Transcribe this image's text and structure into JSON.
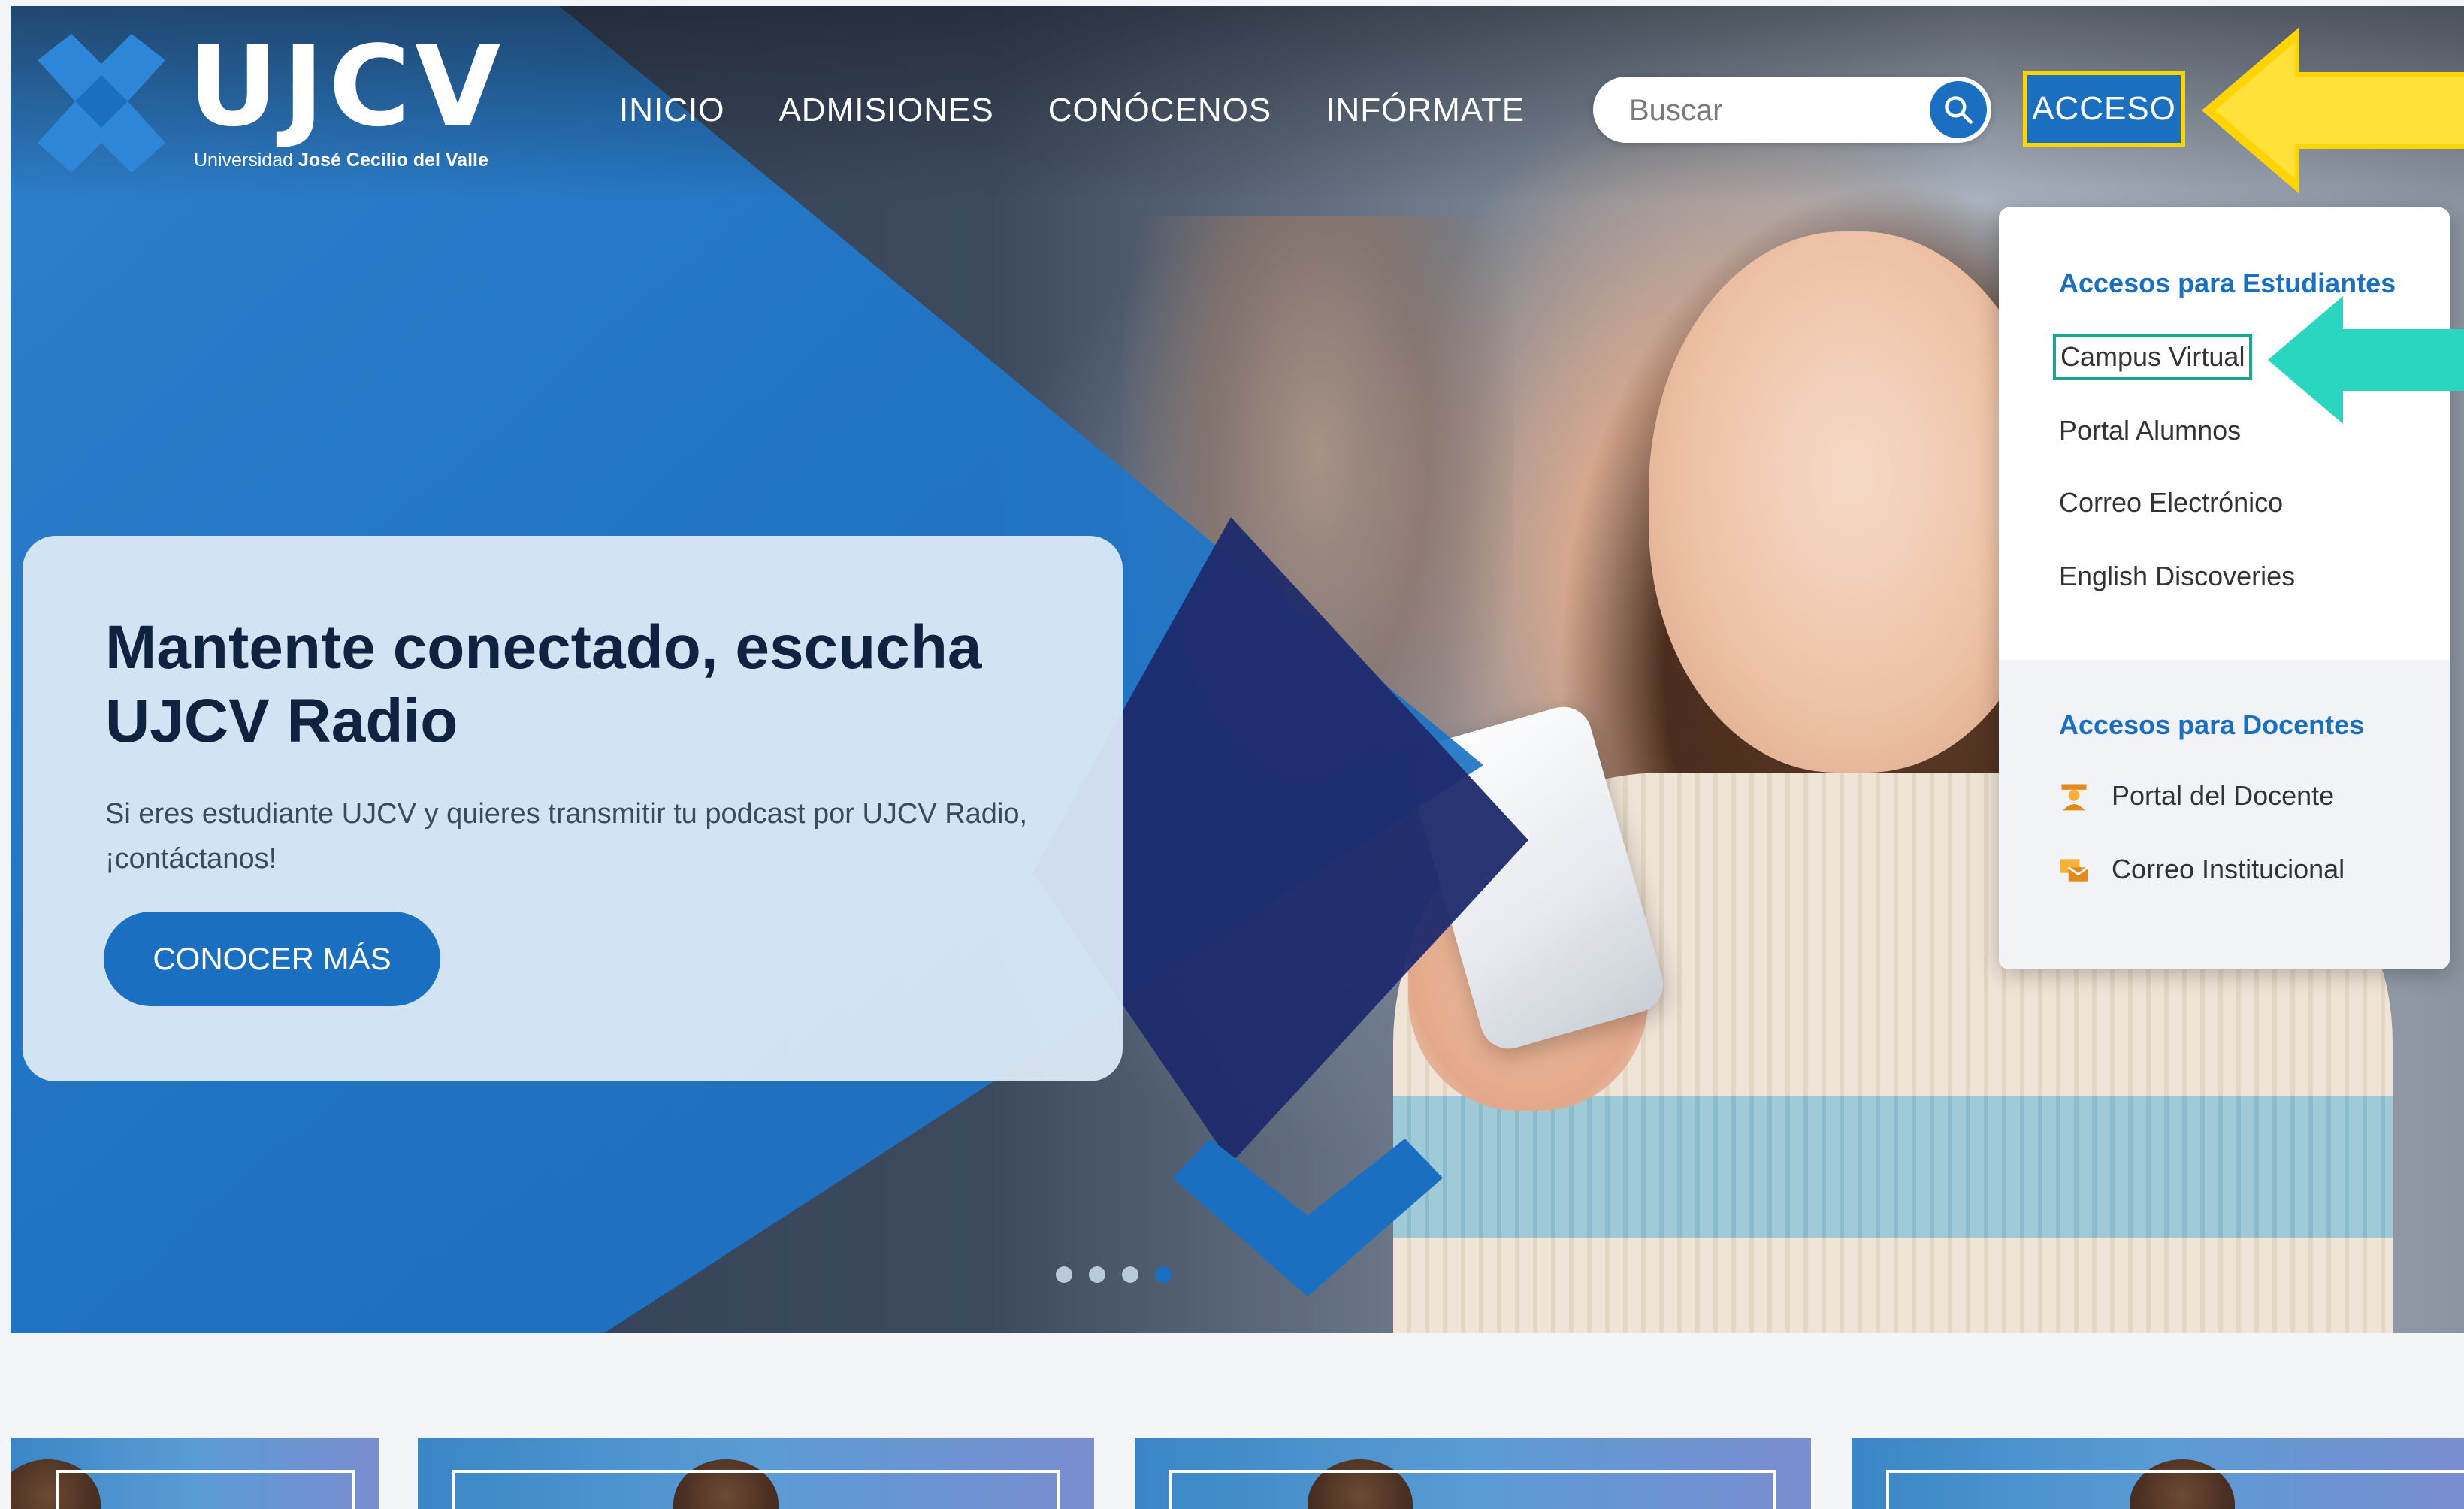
{
  "header": {
    "logo": {
      "text": "UJCV",
      "subtitle_prefix": "Universidad",
      "subtitle_name": "José Cecilio del Valle"
    },
    "nav": [
      "INICIO",
      "ADMISIONES",
      "CONÓCENOS",
      "INFÓRMATE"
    ],
    "search": {
      "placeholder": "Buscar",
      "icon": "search-icon"
    },
    "access_button": "ACCESO"
  },
  "dropdown": {
    "students_heading": "Accesos para Estudiantes",
    "students_links": [
      "Campus Virtual",
      "Portal Alumnos",
      "Correo Electrónico",
      "English Discoveries"
    ],
    "teachers_heading": "Accesos para Docentes",
    "teachers_links": [
      {
        "label": "Portal del Docente",
        "icon": "teacher-icon"
      },
      {
        "label": "Correo Institucional",
        "icon": "mail-icon"
      }
    ]
  },
  "hero": {
    "title": "Mantente conectado, escucha UJCV Radio",
    "text": "Si eres estudiante UJCV y quieres transmitir tu podcast por UJCV Radio, ¡contáctanos!",
    "cta": "CONOCER MÁS",
    "slides_total": 4,
    "active_slide": 4
  },
  "annotations": {
    "yellow_arrow_color": "#ffd400",
    "teal_arrow_color": "#29d6c0",
    "highlight_color": "#1aa58e"
  },
  "colors": {
    "brand_blue": "#1a6fc0",
    "navy": "#1d2a6b",
    "heading_dark": "#0f2340"
  }
}
